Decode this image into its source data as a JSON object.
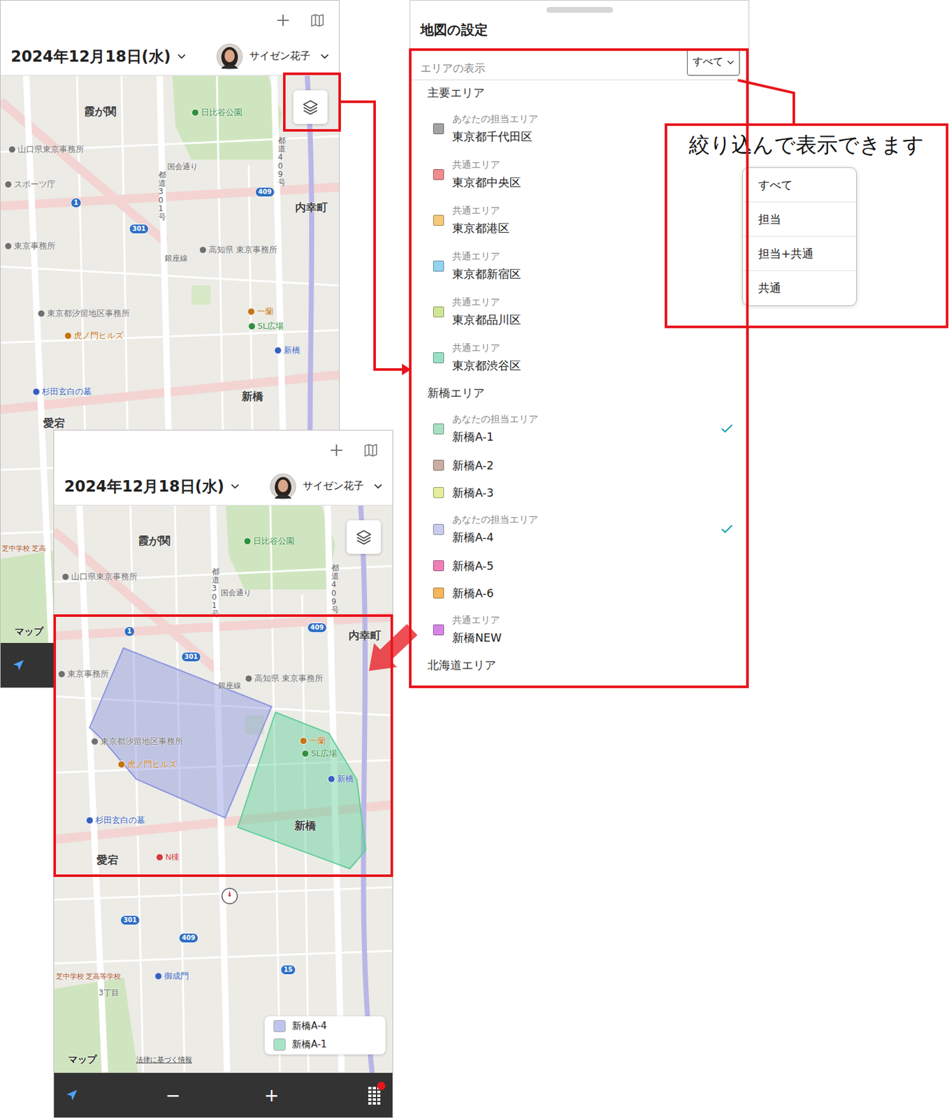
{
  "screens": [
    {
      "date": "2024年12月18日(水)",
      "user": "サイゼン花子",
      "notification": false,
      "controls": [],
      "legend": [],
      "map_labels": [
        {
          "text": "霞が関",
          "kind": "place"
        },
        {
          "text": "日比谷公園",
          "kind": "poi",
          "color": "#2f8f3f"
        },
        {
          "text": "山口県東京事務所",
          "kind": "poi",
          "color": "#6f6f6f"
        },
        {
          "text": "スポーツ庁",
          "kind": "poi",
          "color": "#6f6f6f"
        },
        {
          "text": "国会通り",
          "kind": "road"
        },
        {
          "text": "内幸町",
          "kind": "place"
        },
        {
          "text": "高知県 東京事務所",
          "kind": "poi",
          "color": "#6f6f6f"
        },
        {
          "text": "東京事務所",
          "kind": "poi",
          "color": "#6f6f6f"
        },
        {
          "text": "東京都汐留地区事務所",
          "kind": "poi",
          "color": "#6f6f6f"
        },
        {
          "text": "虎ノ門ヒルズ",
          "kind": "poi",
          "color": "#c47410"
        },
        {
          "text": "一蘭",
          "kind": "poi",
          "color": "#c47410"
        },
        {
          "text": "SL広場",
          "kind": "poi",
          "color": "#2f8f3f"
        },
        {
          "text": "新橋",
          "kind": "poi",
          "color": "#3560c0"
        },
        {
          "text": "杉田玄白の墓",
          "kind": "poi",
          "color": "#3560c0"
        },
        {
          "text": "新橋",
          "kind": "place"
        },
        {
          "text": "愛宕",
          "kind": "place"
        },
        {
          "text": "銀座線",
          "kind": "road"
        },
        {
          "text": "1",
          "kind": "shield"
        },
        {
          "text": "301",
          "kind": "shield"
        },
        {
          "text": "409",
          "kind": "shield"
        },
        {
          "text": "都道301号",
          "kind": "vertical"
        },
        {
          "text": "都道409号",
          "kind": "vertical"
        },
        {
          "text": "芝中学校 芝高",
          "kind": "school"
        },
        {
          "text": "マップ",
          "kind": "brand"
        }
      ]
    },
    {
      "date": "2024年12月18日(水)",
      "user": "サイゼン花子",
      "notification": true,
      "controls": [
        "−",
        "+"
      ],
      "legend": [
        {
          "name": "新橋A-4",
          "color": "#8c95e0"
        },
        {
          "name": "新橋A-1",
          "color": "#5fcf98"
        }
      ],
      "map_labels": [
        {
          "text": "霞が関",
          "kind": "place"
        },
        {
          "text": "日比谷公園",
          "kind": "poi",
          "color": "#2f8f3f"
        },
        {
          "text": "山口県東京事務所",
          "kind": "poi",
          "color": "#6f6f6f"
        },
        {
          "text": "国会通り",
          "kind": "road"
        },
        {
          "text": "内幸町",
          "kind": "place"
        },
        {
          "text": "高知県 東京事務所",
          "kind": "poi",
          "color": "#6f6f6f"
        },
        {
          "text": "東京事務所",
          "kind": "poi",
          "color": "#6f6f6f"
        },
        {
          "text": "東京都汐留地区事務所",
          "kind": "poi",
          "color": "#6f6f6f"
        },
        {
          "text": "虎ノ門ヒルズ",
          "kind": "poi",
          "color": "#c47410"
        },
        {
          "text": "一蘭",
          "kind": "poi",
          "color": "#c47410"
        },
        {
          "text": "SL広場",
          "kind": "poi",
          "color": "#2f8f3f"
        },
        {
          "text": "新橋",
          "kind": "poi",
          "color": "#3560c0"
        },
        {
          "text": "杉田玄白の墓",
          "kind": "poi",
          "color": "#3560c0"
        },
        {
          "text": "新橋",
          "kind": "place"
        },
        {
          "text": "愛宕",
          "kind": "place"
        },
        {
          "text": "N棟",
          "kind": "poi",
          "color": "#d23b3b"
        },
        {
          "text": "銀座線",
          "kind": "road"
        },
        {
          "text": "芝中学校 芝高等学校",
          "kind": "school"
        },
        {
          "text": "3丁目",
          "kind": "road"
        },
        {
          "text": "御成門",
          "kind": "poi",
          "color": "#3560c0"
        },
        {
          "text": "1",
          "kind": "shield"
        },
        {
          "text": "301",
          "kind": "shield"
        },
        {
          "text": "409",
          "kind": "shield"
        },
        {
          "text": "301",
          "kind": "shield"
        },
        {
          "text": "409",
          "kind": "shield"
        },
        {
          "text": "15",
          "kind": "shield"
        },
        {
          "text": "都道301号",
          "kind": "vertical"
        },
        {
          "text": "都道409号",
          "kind": "vertical"
        },
        {
          "text": "マップ",
          "kind": "brand"
        },
        {
          "text": "法律に基づく情報",
          "kind": "legal"
        }
      ]
    }
  ],
  "settings": {
    "title": "地図の設定",
    "filter_label": "エリアの表示",
    "filter_value": "すべて",
    "groups": [
      {
        "name": "主要エリア",
        "areas": [
          {
            "tag": "あなたの担当エリア",
            "name": "東京都千代田区",
            "color": "#a3a3a3",
            "checked": false
          },
          {
            "tag": "共通エリア",
            "name": "東京都中央区",
            "color": "#f28b8b",
            "checked": false
          },
          {
            "tag": "共通エリア",
            "name": "東京都港区",
            "color": "#f6c97a",
            "checked": false
          },
          {
            "tag": "共通エリア",
            "name": "東京都新宿区",
            "color": "#92d3f0",
            "checked": false
          },
          {
            "tag": "共通エリア",
            "name": "東京都品川区",
            "color": "#cfe794",
            "checked": false
          },
          {
            "tag": "共通エリア",
            "name": "東京都渋谷区",
            "color": "#98e0c4",
            "checked": false
          }
        ]
      },
      {
        "name": "新橋エリア",
        "areas": [
          {
            "tag": "あなたの担当エリア",
            "name": "新橋A-1",
            "color": "#a8e0c4",
            "checked": true
          },
          {
            "tag": null,
            "name": "新橋A-2",
            "color": "#c9aea2",
            "checked": false
          },
          {
            "tag": null,
            "name": "新橋A-3",
            "color": "#e6ee9e",
            "checked": false
          },
          {
            "tag": "あなたの担当エリア",
            "name": "新橋A-4",
            "color": "#c9ccee",
            "checked": true
          },
          {
            "tag": null,
            "name": "新橋A-5",
            "color": "#f07fb8",
            "checked": false
          },
          {
            "tag": null,
            "name": "新橋A-6",
            "color": "#f6b65c",
            "checked": false
          },
          {
            "tag": "共通エリア",
            "name": "新橋NEW",
            "color": "#d884e6",
            "checked": false
          }
        ]
      },
      {
        "name": "北海道エリア",
        "areas": []
      }
    ]
  },
  "callout": {
    "text": "絞り込んで表示できます",
    "options": [
      "すべて",
      "担当",
      "担当+共通",
      "共通"
    ]
  }
}
